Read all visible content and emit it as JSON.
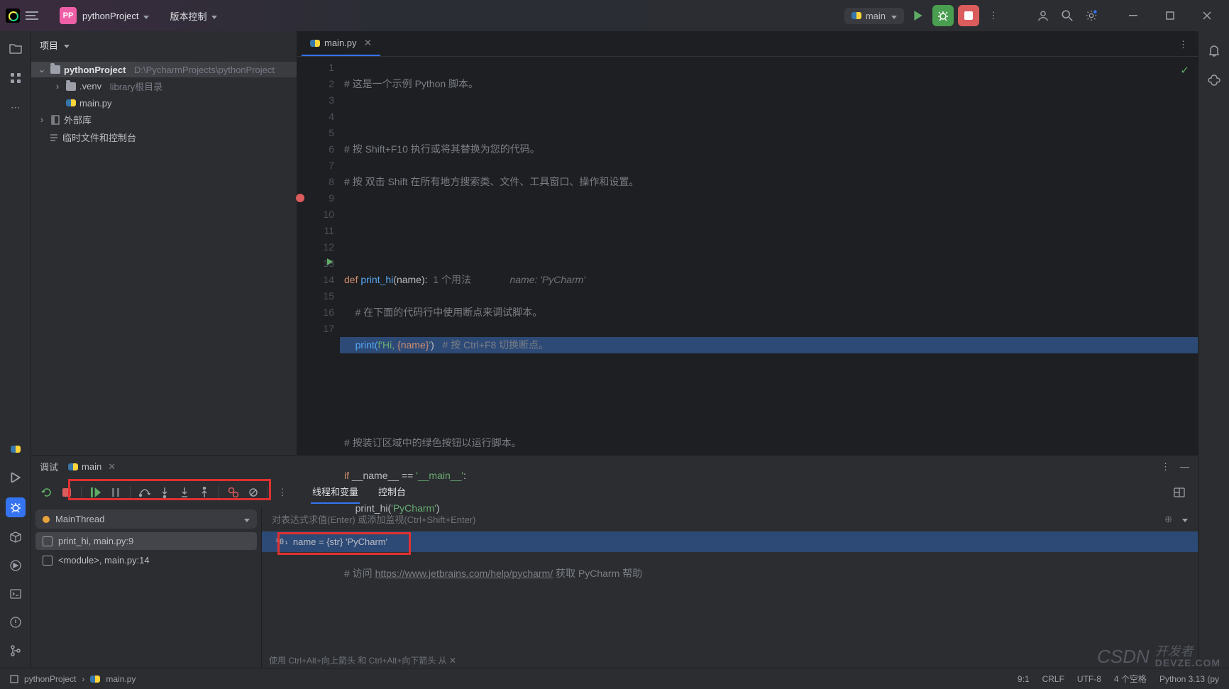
{
  "titlebar": {
    "project_name": "pythonProject",
    "vcs_label": "版本控制",
    "run_config": "main"
  },
  "project_panel": {
    "title": "项目",
    "tree": {
      "root": "pythonProject",
      "root_path": "D:\\PycharmProjects\\pythonProject",
      "venv": ".venv",
      "venv_hint": "library根目录",
      "file": "main.py",
      "ext_lib": "外部库",
      "scratch": "临时文件和控制台"
    }
  },
  "editor": {
    "tab": "main.py",
    "lines": {
      "l1": "# 这是一个示例 Python 脚本。",
      "l3": "# 按 Shift+F10 执行或将其替换为您的代码。",
      "l4": "# 按 双击 Shift 在所有地方搜索类、文件、工具窗口、操作和设置。",
      "l7_def": "def ",
      "l7_fn": "print_hi",
      "l7_par": "(name):",
      "l7_h1": "1 个用法",
      "l7_h2": "name: 'PyCharm'",
      "l8": "# 在下面的代码行中使用断点来调试脚本。",
      "l9_pr": "print(",
      "l9_s1": "f'Hi, ",
      "l9_v": "{name}",
      "l9_s2": "'",
      "l9_cp": ")",
      "l9_c": "# 按 Ctrl+F8 切换断点。",
      "l12": "# 按装订区域中的绿色按钮以运行脚本。",
      "l13_if": "if ",
      "l13_a": "__name__ == ",
      "l13_s": "'__main__'",
      "l13_c": ":",
      "l14_a": "print_hi(",
      "l14_s": "'PyCharm'",
      "l14_b": ")",
      "l16_a": "# 访问 ",
      "l16_url": "https://www.jetbrains.com/help/pycharm/",
      "l16_b": " 获取 PyCharm 帮助"
    }
  },
  "debug": {
    "title": "调试",
    "config": "main",
    "tabs": {
      "threads": "线程和变量",
      "console": "控制台"
    },
    "thread": "MainThread",
    "frames": {
      "f1": "print_hi, main.py:9",
      "f2": "<module>, main.py:14"
    },
    "expr_placeholder": "对表达式求值(Enter) 或添加监视(Ctrl+Shift+Enter)",
    "var": "name = {str} 'PyCharm'",
    "hint": "使用 Ctrl+Alt+向上箭头 和 Ctrl+Alt+向下箭头 从 ✕"
  },
  "status": {
    "crumb_proj": "pythonProject",
    "crumb_file": "main.py",
    "pos": "9:1",
    "eol": "CRLF",
    "enc": "UTF-8",
    "indent": "4 个空格",
    "interp": "Python 3.13 (py"
  },
  "watermark": {
    "a": "CSDN",
    "b": "开发者",
    "c": "DEVZE.COM"
  }
}
